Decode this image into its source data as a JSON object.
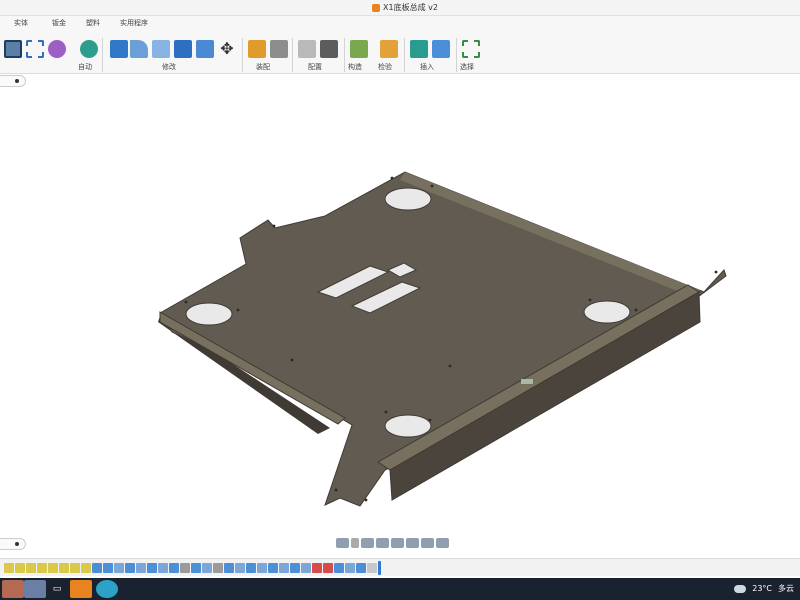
{
  "window": {
    "title": "X1底板总成 v2"
  },
  "ribbon": {
    "tabs": [
      "实体",
      "钣金",
      "塑料",
      "实用程序"
    ],
    "groups": [
      "创建",
      "自动",
      "修改",
      "装配",
      "配置",
      "构造",
      "检验",
      "插入",
      "选择"
    ]
  },
  "taskbar": {
    "weather_temp": "23°C",
    "weather_desc": "多云"
  },
  "colors": {
    "part": "#625b51",
    "part_light": "#77705f",
    "part_dark": "#3f3a33",
    "accent": "#2f7bd6"
  }
}
